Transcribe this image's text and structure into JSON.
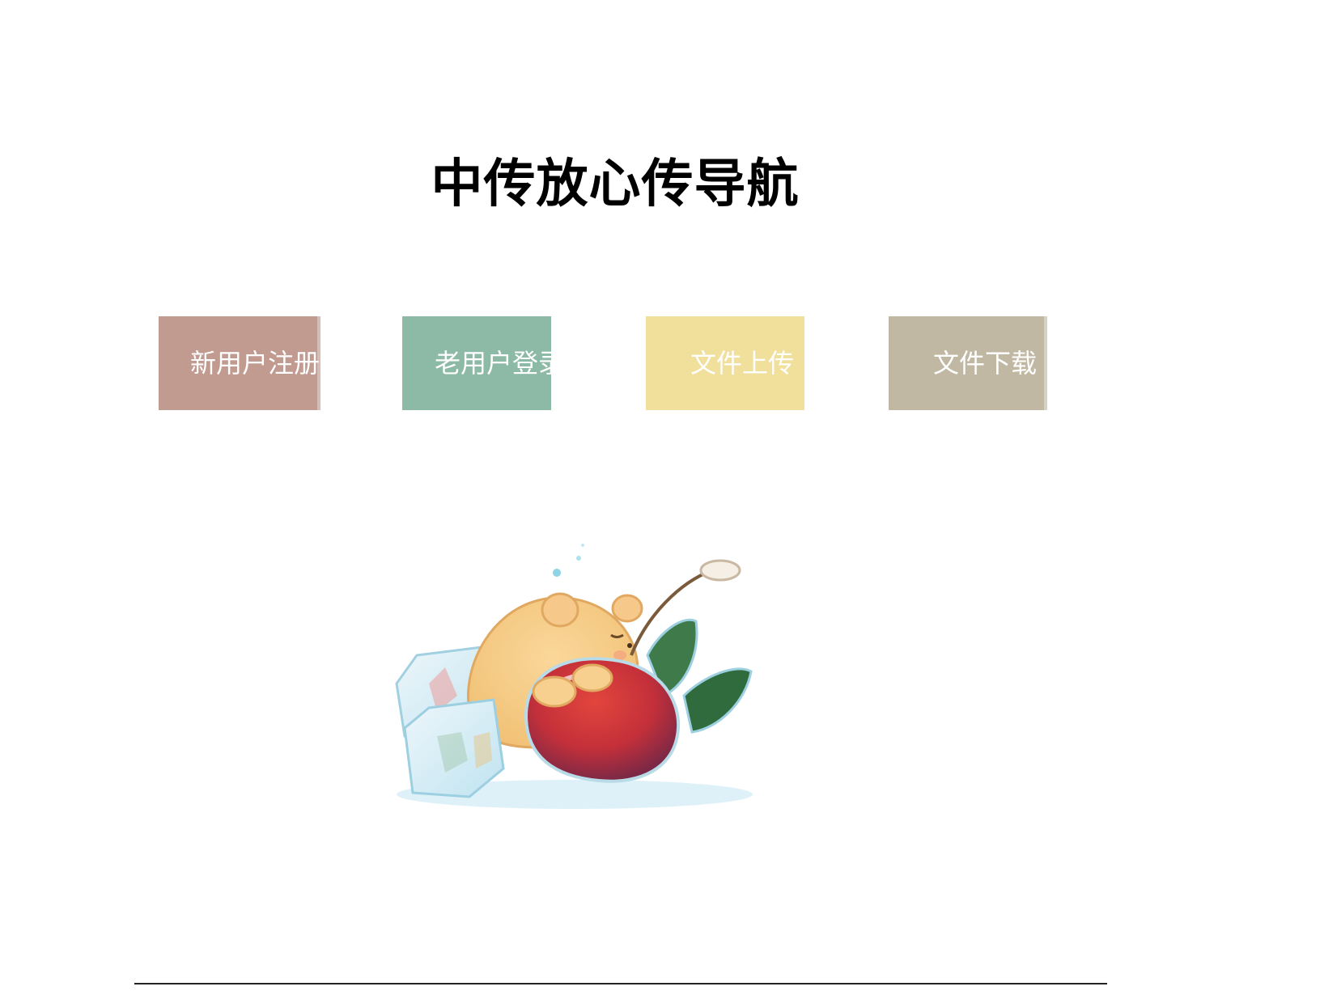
{
  "page": {
    "title": "中传放心传导航"
  },
  "nav": {
    "items": [
      {
        "label": "新用户注册",
        "color": "#c19a90"
      },
      {
        "label": "老用户登录",
        "color": "#8dbaa7"
      },
      {
        "label": "文件上传",
        "color": "#f1df9c"
      },
      {
        "label": "文件下载",
        "color": "#c1b8a3"
      }
    ]
  },
  "illustration": {
    "icon": "bear-hugging-cherry-illustration"
  }
}
